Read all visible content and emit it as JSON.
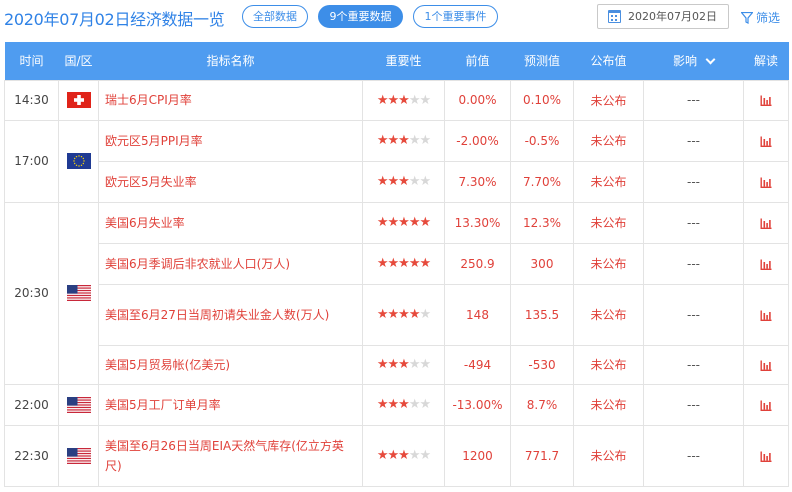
{
  "header": {
    "title": "2020年07月02日经济数据一览",
    "filters": [
      "全部数据",
      "9个重要数据",
      "1个重要事件"
    ],
    "date": "2020年07月02日",
    "filter_label": "筛选"
  },
  "columns": [
    "时间",
    "国/区",
    "指标名称",
    "重要性",
    "前值",
    "预测值",
    "公布值",
    "影响",
    "解读"
  ],
  "rows": [
    {
      "time": "14:30",
      "country": "瑞士",
      "name": "瑞士6月CPI月率",
      "stars": 3,
      "prev": "0.00%",
      "forecast": "0.10%",
      "actual": "未公布",
      "impact": "---"
    },
    {
      "time": "17:00",
      "country": "欧元区",
      "name": "欧元区5月PPI月率",
      "stars": 3,
      "prev": "-2.00%",
      "forecast": "-0.5%",
      "actual": "未公布",
      "impact": "---"
    },
    {
      "time": "",
      "country": "",
      "name": "欧元区5月失业率",
      "stars": 3,
      "prev": "7.30%",
      "forecast": "7.70%",
      "actual": "未公布",
      "impact": "---"
    },
    {
      "time": "20:30",
      "country": "美国",
      "name": "美国6月失业率",
      "stars": 5,
      "prev": "13.30%",
      "forecast": "12.3%",
      "actual": "未公布",
      "impact": "---"
    },
    {
      "time": "",
      "country": "",
      "name": "美国6月季调后非农就业人口(万人)",
      "stars": 5,
      "prev": "250.9",
      "forecast": "300",
      "actual": "未公布",
      "impact": "---"
    },
    {
      "time": "",
      "country": "",
      "name": "美国至6月27日当周初请失业金人数(万人)",
      "stars": 4,
      "prev": "148",
      "forecast": "135.5",
      "actual": "未公布",
      "impact": "---"
    },
    {
      "time": "",
      "country": "",
      "name": "美国5月贸易帐(亿美元)",
      "stars": 3,
      "prev": "-494",
      "forecast": "-530",
      "actual": "未公布",
      "impact": "---"
    },
    {
      "time": "22:00",
      "country": "美国",
      "name": "美国5月工厂订单月率",
      "stars": 3,
      "prev": "-13.00%",
      "forecast": "8.7%",
      "actual": "未公布",
      "impact": "---"
    },
    {
      "time": "22:30",
      "country": "美国",
      "name": "美国至6月26日当周EIA天然气库存(亿立方英尺)",
      "stars": 3,
      "prev": "1200",
      "forecast": "771.7",
      "actual": "未公布",
      "impact": "---"
    }
  ],
  "colors": {
    "accent": "#3d8ee8",
    "header_bg": "#4f9cf0",
    "red": "#e0413a",
    "star_on": "#e64a3c",
    "star_off": "#d8d8d8"
  }
}
